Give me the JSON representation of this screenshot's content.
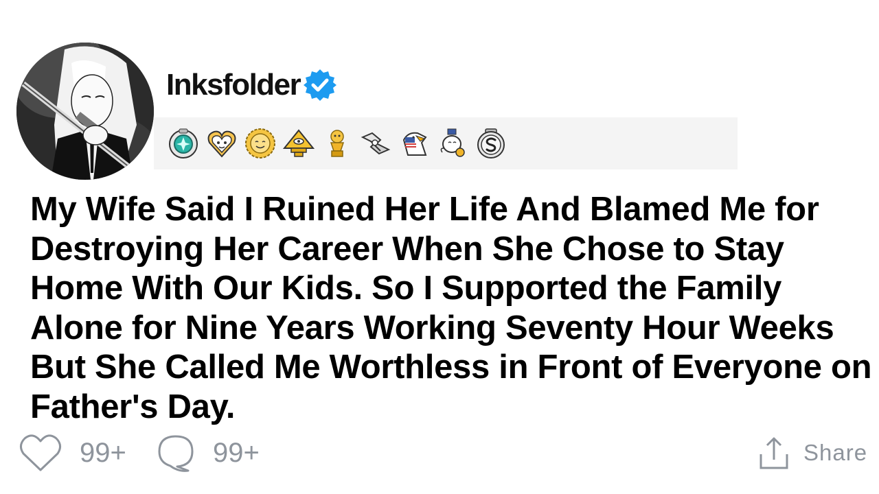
{
  "post": {
    "username": "Inksfolder",
    "verified": true,
    "title": "My Wife Said I Ruined Her Life And Blamed Me for Destroying Her Career When She Chose to Stay Home With Our Kids. So I Supported the Family Alone for Nine Years Working Seventy Hour Weeks But She Called Me Worthless in Front of Everyone on Father's Day."
  },
  "awards": [
    {
      "icon": "helpful-gem-award-icon"
    },
    {
      "icon": "wholesome-heart-award-icon"
    },
    {
      "icon": "sun-face-award-icon"
    },
    {
      "icon": "pyramid-eye-award-icon"
    },
    {
      "icon": "gold-trophy-award-icon"
    },
    {
      "icon": "handshake-award-icon"
    },
    {
      "icon": "eagle-flag-award-icon"
    },
    {
      "icon": "cherub-award-icon"
    },
    {
      "icon": "silver-s-award-icon"
    }
  ],
  "footer": {
    "likes": "99+",
    "comments": "99+",
    "share_label": "Share"
  },
  "colors": {
    "verified_blue": "#1d9bf0",
    "muted_gray": "#8e949c",
    "award_bar_bg": "#f4f4f4"
  }
}
